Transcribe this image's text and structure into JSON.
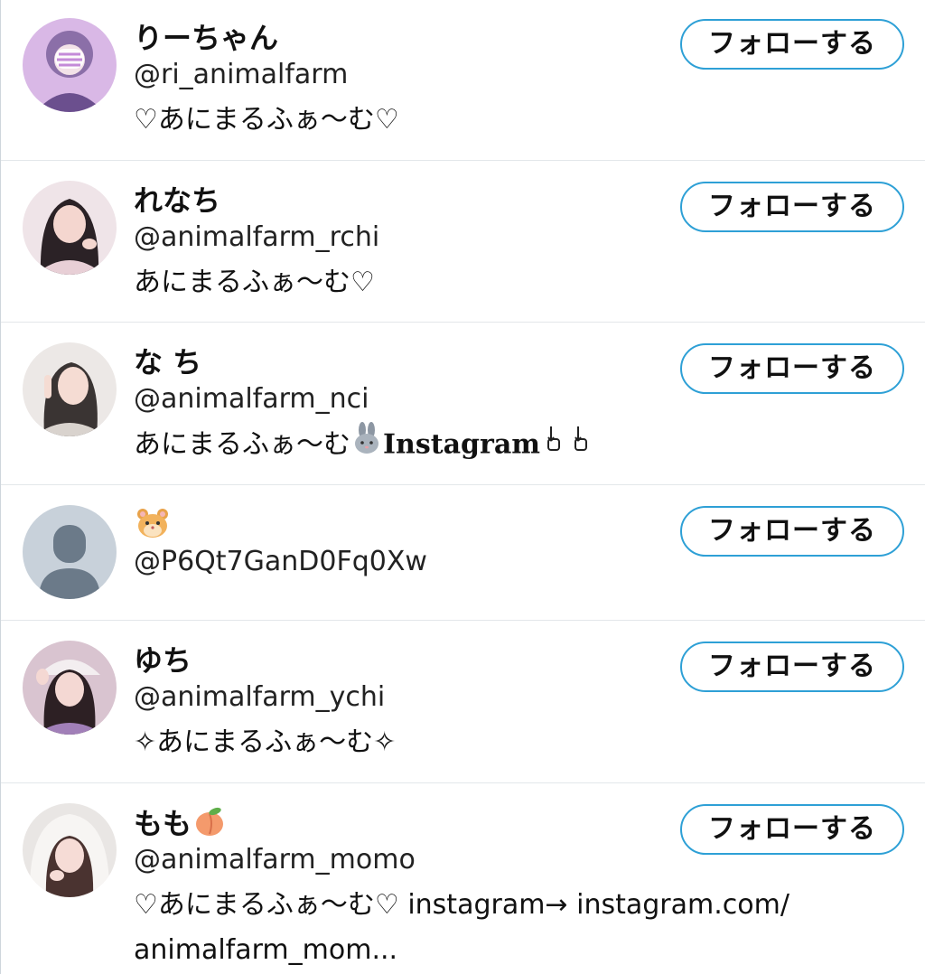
{
  "accent_color": "#2ea0d6",
  "follow_label": "フォローする",
  "users": [
    {
      "name": "りーちゃん",
      "handle": "@ri_animalfarm",
      "bio": "♡あにまるふぁ〜む♡",
      "avatar_icon": "photo-avatar-lavender"
    },
    {
      "name": "れなち",
      "handle": "@animalfarm_rchi",
      "bio": "あにまるふぁ〜む♡",
      "avatar_icon": "photo-avatar-pink"
    },
    {
      "name": "な ち",
      "handle": "@animalfarm_nci",
      "bio_prefix": "あにまるふぁ〜む",
      "bio_rabbit": "🐰",
      "bio_suffix": "Instagram",
      "bio_hands": "👇👇",
      "avatar_icon": "photo-avatar-grey"
    },
    {
      "name_emoji": "🐹",
      "handle": "@P6Qt7GanD0Fq0Xw",
      "avatar_icon": "default-avatar"
    },
    {
      "name": "ゆち",
      "handle": "@animalfarm_ychi",
      "bio": "✧あにまるふぁ〜む✧",
      "avatar_icon": "photo-avatar-purple"
    },
    {
      "name": "もも",
      "name_emoji": "🍑",
      "handle": "@animalfarm_momo",
      "bio_line1": "♡あにまるふぁ〜む♡ instagram→ instagram.com/",
      "bio_line2": "animalfarm_mom...",
      "avatar_icon": "photo-avatar-white-hood"
    }
  ]
}
